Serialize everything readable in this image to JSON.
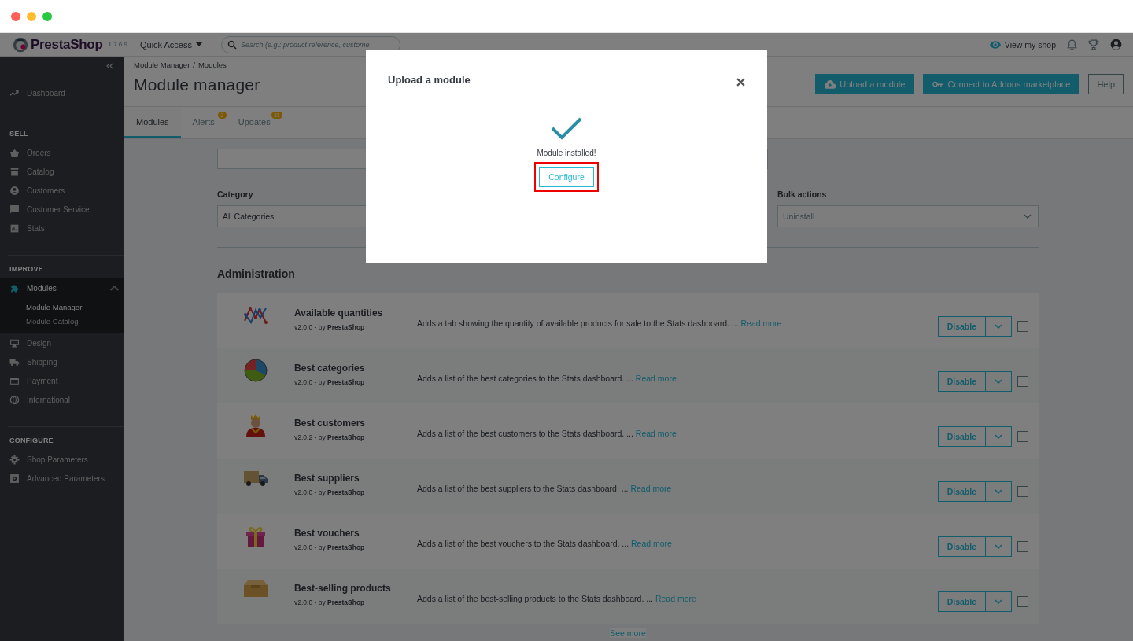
{
  "header": {
    "logo": "PrestaShop",
    "version": "1.7.6.9",
    "quick_access": "Quick Access",
    "search": {
      "placeholder": "Search (e.g.: product reference, custome"
    },
    "view_shop": "View my shop"
  },
  "sidebar": {
    "items": [
      {
        "label": "Dashboard",
        "selected": false
      }
    ],
    "sections": [
      {
        "title": "SELL",
        "items": [
          {
            "label": "Orders",
            "selected": false
          },
          {
            "label": "Catalog",
            "selected": false
          },
          {
            "label": "Customers",
            "selected": false
          },
          {
            "label": "Customer Service",
            "selected": false
          },
          {
            "label": "Stats",
            "selected": false
          }
        ]
      },
      {
        "title": "IMPROVE",
        "items": [
          {
            "label": "Modules",
            "selected": true,
            "expanded": true,
            "children": [
              {
                "label": "Module Manager",
                "selected": true
              },
              {
                "label": "Module Catalog",
                "selected": false
              }
            ]
          },
          {
            "label": "Design",
            "selected": false
          },
          {
            "label": "Shipping",
            "selected": false
          },
          {
            "label": "Payment",
            "selected": false
          },
          {
            "label": "International",
            "selected": false
          }
        ]
      },
      {
        "title": "CONFIGURE",
        "items": [
          {
            "label": "Shop Parameters",
            "selected": false
          },
          {
            "label": "Advanced Parameters",
            "selected": false
          }
        ]
      }
    ]
  },
  "breadcrumb": [
    "Module Manager",
    "Modules"
  ],
  "breadcrumb_separator": "/",
  "page_title": "Module manager",
  "toolbar": [
    {
      "label": "Upload a module",
      "kind": "upload"
    },
    {
      "label": "Connect to Addons marketplace",
      "kind": "connect"
    },
    {
      "label": "Help",
      "kind": "outline"
    }
  ],
  "tabs": [
    {
      "label": "Modules",
      "selected": true
    },
    {
      "label": "Alerts",
      "selected": false,
      "badge": "2"
    },
    {
      "label": "Updates",
      "selected": false,
      "badge": "21"
    }
  ],
  "filters": {
    "category_label": "Category",
    "category_value": "All Categories",
    "bulk_label": "Bulk actions",
    "bulk_value": "Uninstall"
  },
  "section_title": "Administration",
  "modules": [
    {
      "name": "Available quantities",
      "meta": "v2.0.0 - by **PrestaShop**",
      "description": "Adds a tab showing the quantity of available products for sale to the Stats dashboard. ...",
      "read_more": "Read more",
      "action": "Disable",
      "checked": false
    },
    {
      "name": "Best categories",
      "meta": "v2.0.0 - by **PrestaShop**",
      "description": "Adds a list of the best categories to the Stats dashboard. ...",
      "read_more": "Read more",
      "action": "Disable",
      "checked": false
    },
    {
      "name": "Best customers",
      "meta": "v2.0.2 - by **PrestaShop**",
      "description": "Adds a list of the best customers to the Stats dashboard. ...",
      "read_more": "Read more",
      "action": "Disable",
      "checked": false
    },
    {
      "name": "Best suppliers",
      "meta": "v2.0.0 - by **PrestaShop**",
      "description": "Adds a list of the best suppliers to the Stats dashboard. ...",
      "read_more": "Read more",
      "action": "Disable",
      "checked": false
    },
    {
      "name": "Best vouchers",
      "meta": "v2.0.0 - by **PrestaShop**",
      "description": "Adds a list of the best vouchers to the Stats dashboard. ...",
      "read_more": "Read more",
      "action": "Disable",
      "checked": false
    },
    {
      "name": "Best-selling products",
      "meta": "v2.0.0 - by **PrestaShop**",
      "description": "Adds a list of the best-selling products to the Stats dashboard. ...",
      "read_more": "Read more",
      "action": "Disable",
      "checked": false
    }
  ],
  "see_more": "See more",
  "modal": {
    "title": "Upload a module",
    "message": "Module installed!",
    "button": {
      "label": "Configure",
      "highlighted": true
    }
  }
}
